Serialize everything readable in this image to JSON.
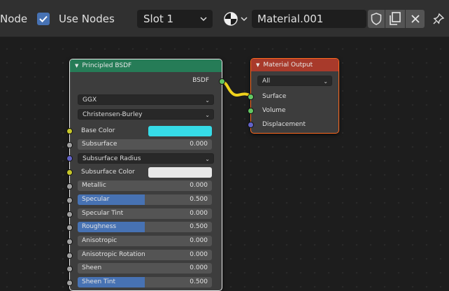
{
  "header": {
    "editor_label": "Node",
    "use_nodes_label": "Use Nodes",
    "use_nodes_checked": true,
    "slot": "Slot 1",
    "material_name": "Material.001"
  },
  "colors": {
    "accent": "#4772b3",
    "shader_header": "#267c57",
    "output_header": "#a83a2b",
    "base_color": "#36dce8",
    "subsurface_color": "#e8e8e8",
    "link": "#f0d21c"
  },
  "principled": {
    "title": "Principled BSDF",
    "output_label": "BSDF",
    "distribution": "GGX",
    "subsurface_method": "Christensen-Burley",
    "base_color_label": "Base Color",
    "subsurface": {
      "label": "Subsurface",
      "value": "0.000",
      "fraction": 0
    },
    "subsurface_radius_label": "Subsurface Radius",
    "subsurface_color_label": "Subsurface Color",
    "metallic": {
      "label": "Metallic",
      "value": "0.000",
      "fraction": 0
    },
    "specular": {
      "label": "Specular",
      "value": "0.500",
      "fraction": 0.5
    },
    "specular_tint": {
      "label": "Specular Tint",
      "value": "0.000",
      "fraction": 0
    },
    "roughness": {
      "label": "Roughness",
      "value": "0.500",
      "fraction": 0.5
    },
    "anisotropic": {
      "label": "Anisotropic",
      "value": "0.000",
      "fraction": 0
    },
    "anisotropic_rotation": {
      "label": "Anisotropic Rotation",
      "value": "0.000",
      "fraction": 0
    },
    "sheen": {
      "label": "Sheen",
      "value": "0.000",
      "fraction": 0
    },
    "sheen_tint": {
      "label": "Sheen Tint",
      "value": "0.500",
      "fraction": 0.5
    }
  },
  "material_output": {
    "title": "Material Output",
    "target": "All",
    "inputs": [
      "Surface",
      "Volume",
      "Displacement"
    ]
  }
}
